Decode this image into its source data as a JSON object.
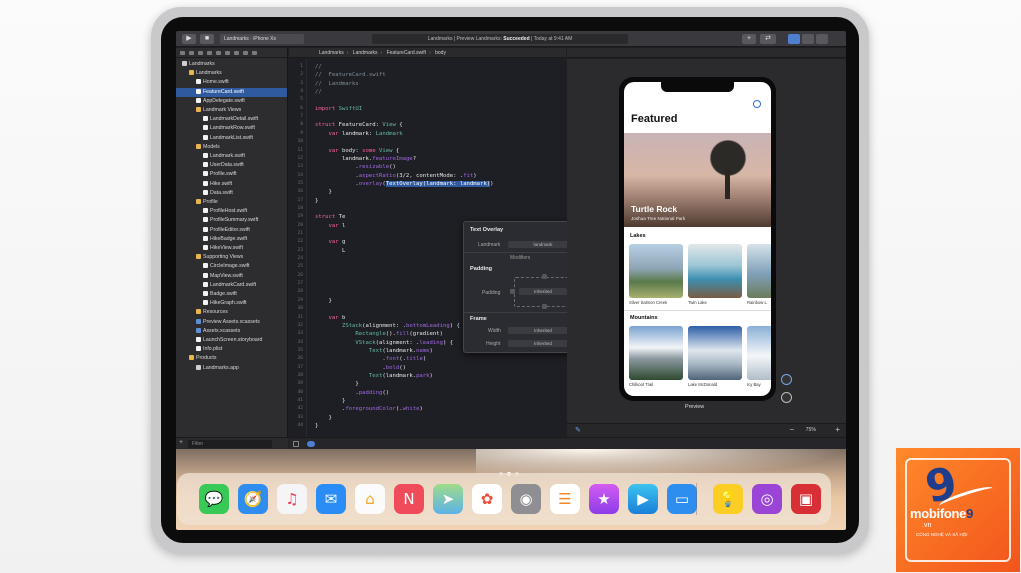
{
  "toolbar": {
    "run_icon": "play-icon",
    "stop_icon": "stop-icon",
    "scheme": "Landmarks",
    "device": "iPhone Xs",
    "status_prefix": "Landmarks | Preview Landmarks:",
    "status_bold": "Succeeded",
    "status_suffix": "| Today at 9:41 AM"
  },
  "navigator": {
    "items": [
      {
        "label": "Landmarks",
        "kind": "a",
        "indent": 0
      },
      {
        "label": "Landmarks",
        "kind": "f",
        "indent": 1
      },
      {
        "label": "Home.swift",
        "kind": "s",
        "indent": 2
      },
      {
        "label": "FeatureCard.swift",
        "kind": "s",
        "indent": 2,
        "selected": true
      },
      {
        "label": "AppDelegate.swift",
        "kind": "s",
        "indent": 2
      },
      {
        "label": "Landmark Views",
        "kind": "f",
        "indent": 2
      },
      {
        "label": "LandmarkDetail.swift",
        "kind": "s",
        "indent": 3
      },
      {
        "label": "LandmarkRow.swift",
        "kind": "s",
        "indent": 3
      },
      {
        "label": "LandmarkList.swift",
        "kind": "s",
        "indent": 3
      },
      {
        "label": "Models",
        "kind": "f",
        "indent": 2
      },
      {
        "label": "Landmark.swift",
        "kind": "s",
        "indent": 3
      },
      {
        "label": "UserData.swift",
        "kind": "s",
        "indent": 3
      },
      {
        "label": "Profile.swift",
        "kind": "s",
        "indent": 3
      },
      {
        "label": "Hike.swift",
        "kind": "s",
        "indent": 3
      },
      {
        "label": "Data.swift",
        "kind": "s",
        "indent": 3
      },
      {
        "label": "Profile",
        "kind": "f",
        "indent": 2
      },
      {
        "label": "ProfileHost.swift",
        "kind": "s",
        "indent": 3
      },
      {
        "label": "ProfileSummary.swift",
        "kind": "s",
        "indent": 3
      },
      {
        "label": "ProfileEditor.swift",
        "kind": "s",
        "indent": 3
      },
      {
        "label": "HikeBadge.swift",
        "kind": "s",
        "indent": 3
      },
      {
        "label": "HikeView.swift",
        "kind": "s",
        "indent": 3
      },
      {
        "label": "Supporting Views",
        "kind": "f",
        "indent": 2
      },
      {
        "label": "CircleImage.swift",
        "kind": "s",
        "indent": 3
      },
      {
        "label": "MapView.swift",
        "kind": "s",
        "indent": 3
      },
      {
        "label": "LandmarkCard.swift",
        "kind": "s",
        "indent": 3
      },
      {
        "label": "Badge.swift",
        "kind": "s",
        "indent": 3
      },
      {
        "label": "HikeGraph.swift",
        "kind": "s",
        "indent": 3
      },
      {
        "label": "Resources",
        "kind": "f",
        "indent": 2
      },
      {
        "label": "Preview Assets.xcassets",
        "kind": "b",
        "indent": 2
      },
      {
        "label": "Assets.xcassets",
        "kind": "b",
        "indent": 2
      },
      {
        "label": "LaunchScreen.storyboard",
        "kind": "s",
        "indent": 2
      },
      {
        "label": "Info.plist",
        "kind": "s",
        "indent": 2
      },
      {
        "label": "Products",
        "kind": "f",
        "indent": 1
      },
      {
        "label": "Landmarks.app",
        "kind": "a",
        "indent": 2
      }
    ],
    "filter_placeholder": "Filter"
  },
  "jumpbar": {
    "crumbs": [
      "Landmarks",
      "Landmarks",
      "FeatureCard.swift",
      "body"
    ]
  },
  "editor": {
    "lines": [
      "//",
      "//  FeatureCard.swift",
      "//  Landmarks",
      "//",
      "",
      "import SwiftUI",
      "",
      "struct FeatureCard: View {",
      "    var landmark: Landmark",
      "",
      "    var body: some View {",
      "        landmark.featureImage?",
      "            .resizable()",
      "            .aspectRatio(3/2, contentMode: .fit)",
      "            .overlay(TextOverlay(landmark: landmark))",
      "    }",
      "}",
      "",
      "struct Te",
      "    var l",
      "",
      "    var g",
      "        L",
      "",
      "",
      "",
      "",
      "",
      "    }",
      "",
      "    var b",
      "        ZStack(alignment: .bottomLeading) {",
      "            Rectangle().fill(gradient)",
      "            VStack(alignment: .leading) {",
      "                Text(landmark.name)",
      "                    .font(.title)",
      "                    .bold()",
      "                Text(landmark.park)",
      "            }",
      "            .padding()",
      "        }",
      "        .foregroundColor(.white)",
      "    }",
      "}"
    ],
    "line_numbers": [
      "1",
      "2",
      "3",
      "4",
      "5",
      "6",
      "7",
      "8",
      "9",
      "10",
      "11",
      "12",
      "13",
      "14",
      "15",
      "16",
      "17",
      "18",
      "19",
      "20",
      "21",
      "22",
      "23",
      "24",
      "25",
      "26",
      "27",
      "28",
      "29",
      "30",
      "31",
      "32",
      "33",
      "34",
      "35",
      "36",
      "37",
      "38",
      "39",
      "40",
      "41",
      "42",
      "43",
      "44"
    ]
  },
  "inspector": {
    "title": "Text Overlay",
    "landmark_label": "Landmark",
    "landmark_value": "landmark",
    "modifiers": "Modifiers",
    "padding_header": "Padding",
    "padding_label": "Padding",
    "padding_value": "Inherited",
    "frame_header": "Frame",
    "width_label": "Width",
    "width_value": "Inherited",
    "height_label": "Height",
    "height_value": "Inherited"
  },
  "preview": {
    "title": "Featured",
    "hero_title": "Turtle Rock",
    "hero_subtitle": "Joshua Tree National Park",
    "section1": "Lakes",
    "lakes": [
      "Silver Salmon Creek",
      "Twin Lake",
      "Rainbow L"
    ],
    "section2": "Mountains",
    "mountains": [
      "Chilkoot Trail",
      "Lake McDonald",
      "Icy Bay"
    ],
    "label": "Preview",
    "zoom": "75%"
  },
  "dock": {
    "apps": [
      "Messages",
      "Safari",
      "Music",
      "Mail",
      "Home",
      "News",
      "Maps",
      "Photos",
      "Camera",
      "Reminders",
      "iTunes Store",
      "Clips",
      "Files",
      "Tips",
      "Podcasts",
      "Photo Booth"
    ]
  },
  "brand": {
    "name_prefix": "mobifone",
    "name_num": "9",
    "domain": ".vn",
    "tagline": "CÔNG NGHỆ VÀ XÃ HỘI"
  },
  "colors": {
    "selection": "#2f5aa0",
    "keyword": "#fc5fa3",
    "type": "#67b7a4",
    "brand_orange": "#f2541b"
  }
}
